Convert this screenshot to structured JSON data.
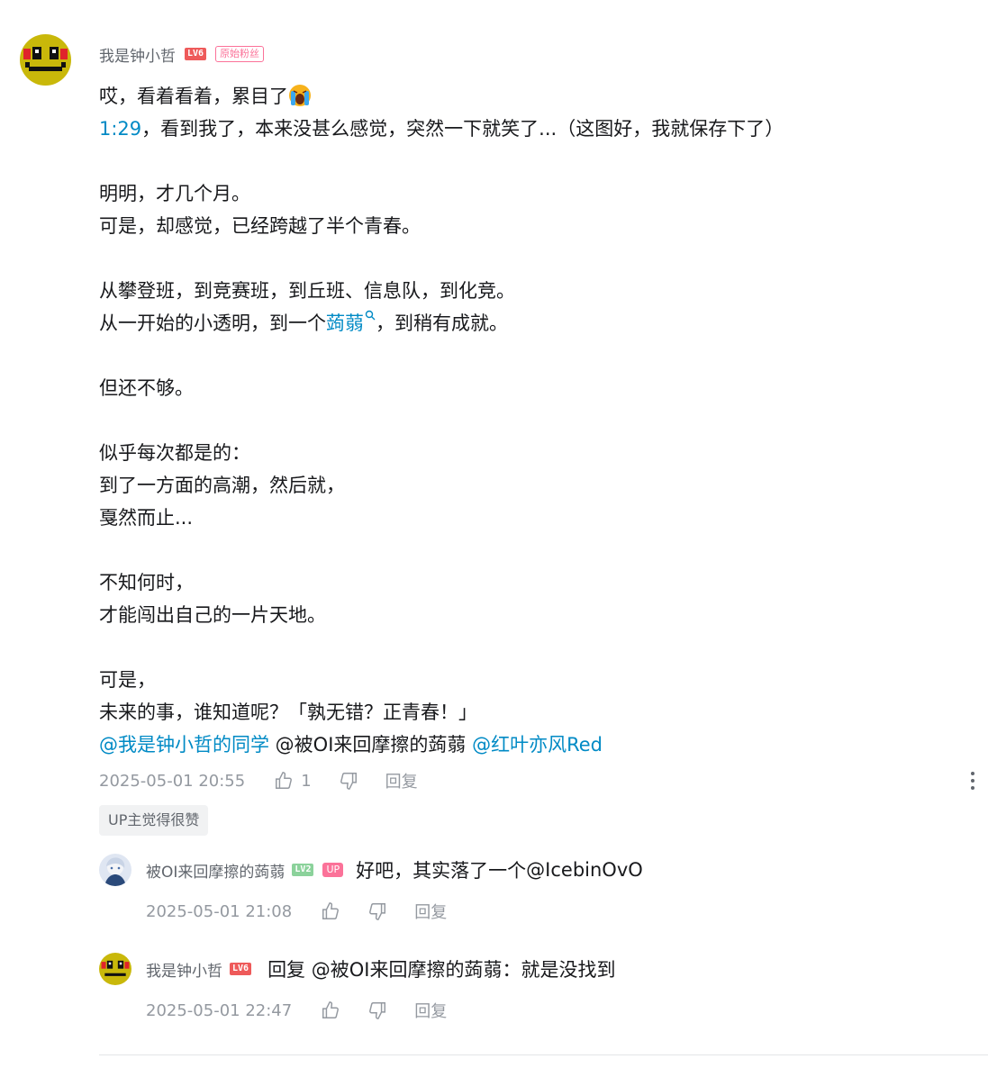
{
  "main_comment": {
    "username": "我是钟小哲",
    "level": "LV6",
    "fan_badge": "原始粉丝",
    "lines": [
      {
        "segments": [
          {
            "text": "哎，看着看着，累目了"
          }
        ],
        "emoji": "crying-emoji"
      },
      {
        "segments": [
          {
            "text": "1:29",
            "link": true
          },
          {
            "text": "，看到我了，本来没甚么感觉，突然一下就笑了...（这图好，我就保存下了）"
          }
        ]
      },
      {
        "segments": []
      },
      {
        "segments": [
          {
            "text": "明明，才几个月。"
          }
        ]
      },
      {
        "segments": [
          {
            "text": "可是，却感觉，已经跨越了半个青春。"
          }
        ]
      },
      {
        "segments": []
      },
      {
        "segments": [
          {
            "text": "从攀登班，到竞赛班，到丘班、信息队，到化竞。"
          }
        ]
      },
      {
        "segments": [
          {
            "text": "从一开始的小透明，到一个"
          },
          {
            "text": "蒟蒻",
            "link": true,
            "search": true
          },
          {
            "text": "，到稍有成就。"
          }
        ]
      },
      {
        "segments": []
      },
      {
        "segments": [
          {
            "text": "但还不够。"
          }
        ]
      },
      {
        "segments": []
      },
      {
        "segments": [
          {
            "text": "似乎每次都是的："
          }
        ]
      },
      {
        "segments": [
          {
            "text": "到了一方面的高潮，然后就，"
          }
        ]
      },
      {
        "segments": [
          {
            "text": "戛然而止..."
          }
        ]
      },
      {
        "segments": []
      },
      {
        "segments": [
          {
            "text": "不知何时，"
          }
        ]
      },
      {
        "segments": [
          {
            "text": "才能闯出自己的一片天地。"
          }
        ]
      },
      {
        "segments": []
      },
      {
        "segments": [
          {
            "text": "可是，"
          }
        ]
      },
      {
        "segments": [
          {
            "text": "未来的事，谁知道呢？「孰无错？正青春！」"
          }
        ]
      },
      {
        "segments": [
          {
            "text": "@我是钟小哲的同学",
            "link": true
          },
          {
            "text": " @被OI来回摩擦的蒟蒻 "
          },
          {
            "text": "@红叶亦风Red",
            "link": true
          }
        ]
      }
    ],
    "timestamp": "2025-05-01 20:55",
    "like_count": "1",
    "reply_label": "回复",
    "up_liked": "UP主觉得很赞"
  },
  "replies": [
    {
      "username": "被OI来回摩擦的蒟蒻",
      "level": "LV2",
      "up_tag": "UP",
      "text_plain": "好吧，其实落了一个",
      "mention": "@IcebinOvO",
      "timestamp": "2025-05-01 21:08",
      "reply_label": "回复"
    },
    {
      "username": "我是钟小哲",
      "level": "LV6",
      "reply_prefix": "回复 ",
      "mention": "@被OI来回摩擦的蒟蒻",
      "text_plain": "：就是没找到",
      "timestamp": "2025-05-01 22:47",
      "reply_label": "回复"
    }
  ],
  "colors": {
    "link": "#008ac5",
    "level_red": "#ee5a5a",
    "level_green": "#8bd29b",
    "pink": "#fb7299",
    "meta": "#9499a0"
  }
}
